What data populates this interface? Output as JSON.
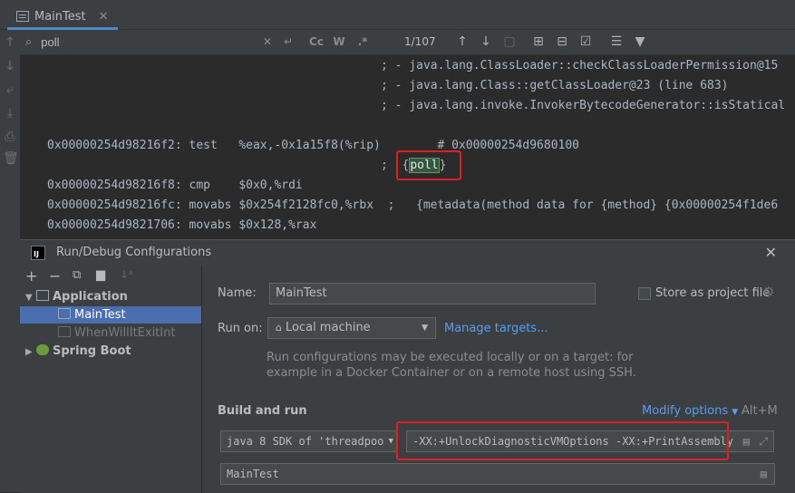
{
  "editor": {
    "tab_title": "MainTest",
    "search": {
      "query": "poll",
      "match_count": "1/107",
      "case_label": "Cc",
      "word_label": "W",
      "regex_label": ".*"
    },
    "code_lines": [
      "; - java.lang.ClassLoader::checkClassLoaderPermission@15",
      "; - java.lang.Class::getClassLoader@23 (line 683)",
      "; - java.lang.invoke.InvokerBytecodeGenerator::isStatical",
      "0x00000254d98216f2: test   %eax,-0x1a15f8(%rip)        # 0x00000254d9680100",
      ";  {",
      "poll",
      "}",
      "0x00000254d98216f8: cmp    $0x0,%rdi",
      "0x00000254d98216fc: movabs $0x254f2128fc0,%rbx  ;   {metadata(method data for {method} {0x00000254f1de6",
      "0x00000254d9821706: movabs $0x128,%rax"
    ]
  },
  "dialog": {
    "title": "Run/Debug Configurations",
    "tree": {
      "application": "Application",
      "main_test": "MainTest",
      "when_will": "WhenWillItExitInt",
      "spring_boot": "Spring Boot"
    },
    "name_label": "Name:",
    "name_value": "MainTest",
    "store_label": "Store as project file",
    "run_on_label": "Run on:",
    "run_on_value": "Local machine",
    "manage_targets": "Manage targets...",
    "run_on_help_1": "Run configurations may be executed locally or on a target: for",
    "run_on_help_2": "example in a Docker Container or on a remote host using SSH.",
    "build_run_label": "Build and run",
    "modify_options": "Modify options",
    "modify_shortcut": "Alt+M",
    "sdk_value": "java 8 SDK of 'threadpoo",
    "vm_options": "-XX:+UnlockDiagnosticVMOptions -XX:+PrintAssembly",
    "main_class": "MainTest"
  },
  "colors": {
    "accent": "#4a88c7",
    "highlight_box": "#e02020",
    "link": "#589df6"
  }
}
